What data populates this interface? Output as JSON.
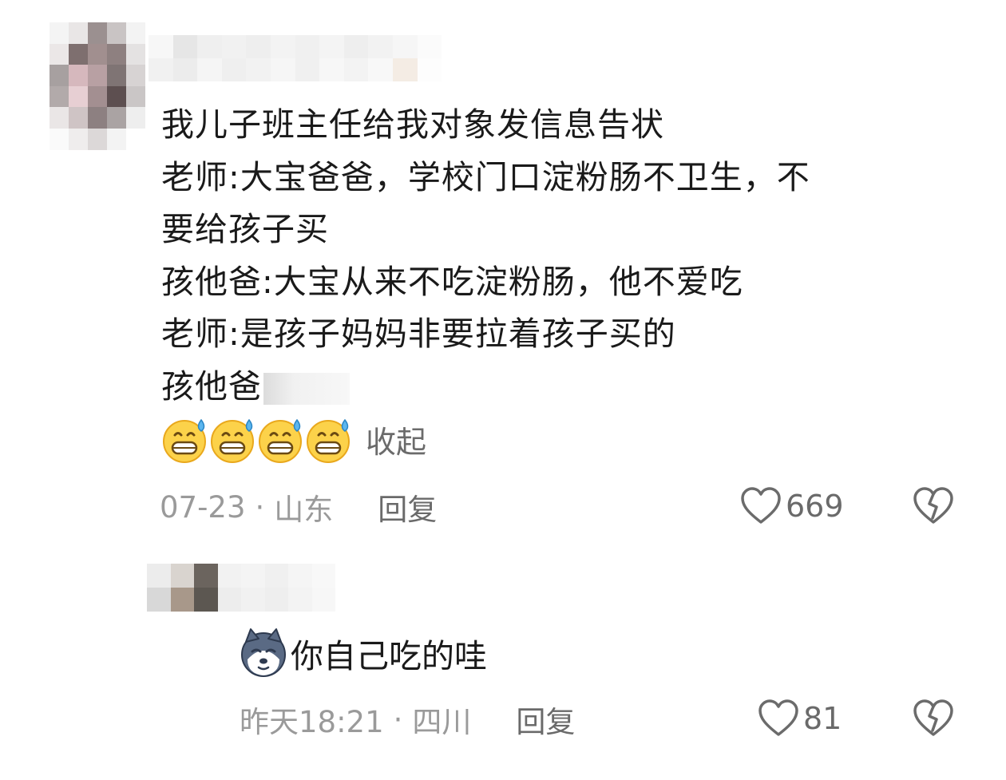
{
  "comment": {
    "lines": [
      "我儿子班主任给我对象发信息告状",
      "老师:大宝爸爸，学校门口淀粉肠不卫生，不",
      "要给孩子买",
      "孩他爸:大宝从来不吃淀粉肠，他不爱吃",
      "老师:是孩子妈妈非要拉着孩子买的",
      "孩他爸"
    ],
    "emoji_names": [
      "grin-sweat-emoji",
      "grin-sweat-emoji",
      "grin-sweat-emoji",
      "grin-sweat-emoji"
    ],
    "collapse_label": "收起",
    "date": "07-23",
    "separator": "·",
    "location": "山东",
    "reply_label": "回复",
    "like_count": "669"
  },
  "reply": {
    "sticker_name": "husky-dog-sticker",
    "text": "你自己吃的哇",
    "time": "昨天18:21",
    "separator": "·",
    "location": "四川",
    "reply_label": "回复",
    "like_count": "81"
  },
  "colors": {
    "text_primary": "#1a1a1a",
    "text_meta": "#9a9a9a",
    "text_action": "#6a6a6a",
    "icon_stroke": "#6b6b6b"
  },
  "icons": {
    "like": "heart-outline-icon",
    "dislike": "broken-heart-icon"
  }
}
